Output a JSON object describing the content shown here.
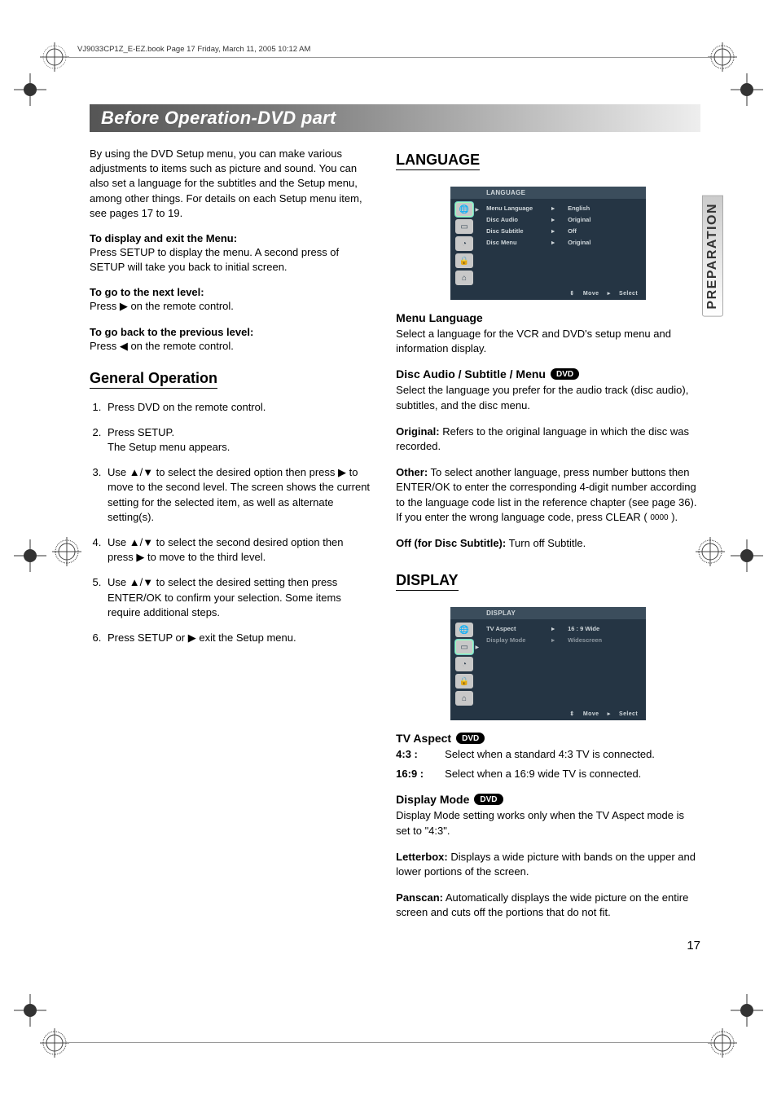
{
  "print_header": "VJ9033CP1Z_E-EZ.book  Page 17  Friday, March 11, 2005  10:12 AM",
  "title": "Before Operation-DVD part",
  "side_tab": "PREPARATION",
  "page_number": "17",
  "intro": "By using the DVD Setup menu, you can make various adjustments to items such as picture and sound. You can also set a language for the subtitles and the Setup menu, among other things. For details on each Setup menu item, see pages 17 to 19.",
  "display_exit_head": "To display and exit the Menu:",
  "display_exit_body": "Press SETUP to display the menu. A second press of SETUP will take you back to initial screen.",
  "next_level_head": "To go to the next level:",
  "next_level_body": "Press ▶ on the remote control.",
  "prev_level_head": "To go back to the previous level:",
  "prev_level_body": "Press ◀ on the remote control.",
  "general_op_head": "General Operation",
  "steps": [
    "Press DVD on the remote control.",
    "Press SETUP.\nThe Setup menu appears.",
    "Use ▲/▼ to select the desired option then press ▶ to move to the second level. The screen shows the current setting for the selected item, as well as alternate setting(s).",
    "Use ▲/▼ to select the second desired option then press ▶ to move to the third level.",
    "Use ▲/▼ to select the desired setting then press ENTER/OK to confirm your selection. Some items require additional steps.",
    "Press SETUP or ▶  exit the Setup menu."
  ],
  "language_head": "LANGUAGE",
  "osd_lang": {
    "title": "LANGUAGE",
    "rows": [
      {
        "label": "Menu Language",
        "value": "English"
      },
      {
        "label": "Disc Audio",
        "value": "Original"
      },
      {
        "label": "Disc Subtitle",
        "value": "Off"
      },
      {
        "label": "Disc Menu",
        "value": "Original"
      }
    ],
    "footer_move": "Move",
    "footer_select": "Select"
  },
  "menu_lang_head": "Menu Language",
  "menu_lang_body": "Select a language for the VCR and DVD's setup menu and information display.",
  "disc_asm_head": "Disc Audio / Subtitle / Menu",
  "dvd_pill": "DVD",
  "disc_asm_body": "Select the language you prefer for the audio track (disc audio), subtitles, and the disc menu.",
  "original_lbl": "Original:",
  "original_body": " Refers to the original language in which the disc was recorded.",
  "other_lbl": "Other:",
  "other_body": " To select another language, press number buttons then ENTER/OK to enter the corresponding 4-digit number according to the language code list in the reference chapter (see page 36). If you enter the wrong language code, press CLEAR ( ",
  "other_code": "0000",
  "other_body_tail": " ).",
  "off_lbl": "Off (for Disc Subtitle):",
  "off_body": " Turn off Subtitle.",
  "display_head": "DISPLAY",
  "osd_disp": {
    "title": "DISPLAY",
    "rows": [
      {
        "label": "TV Aspect",
        "value": "16 : 9 Wide",
        "dim": false
      },
      {
        "label": "Display Mode",
        "value": "Widescreen",
        "dim": true
      }
    ],
    "footer_move": "Move",
    "footer_select": "Select"
  },
  "tv_aspect_head": "TV Aspect",
  "aspect_43_lbl": "4:3 :",
  "aspect_43_body": "Select when a standard 4:3 TV is connected.",
  "aspect_169_lbl": "16:9 :",
  "aspect_169_body": "Select when a 16:9 wide TV is connected.",
  "disp_mode_head": "Display Mode",
  "disp_mode_body": "Display Mode setting works only when the TV Aspect mode is set to \"4:3\".",
  "letterbox_lbl": "Letterbox:",
  "letterbox_body": " Displays a wide picture with bands on the upper and lower portions of the screen.",
  "panscan_lbl": "Panscan:",
  "panscan_body": " Automatically displays the wide picture on the entire screen and cuts off the portions that do not fit."
}
